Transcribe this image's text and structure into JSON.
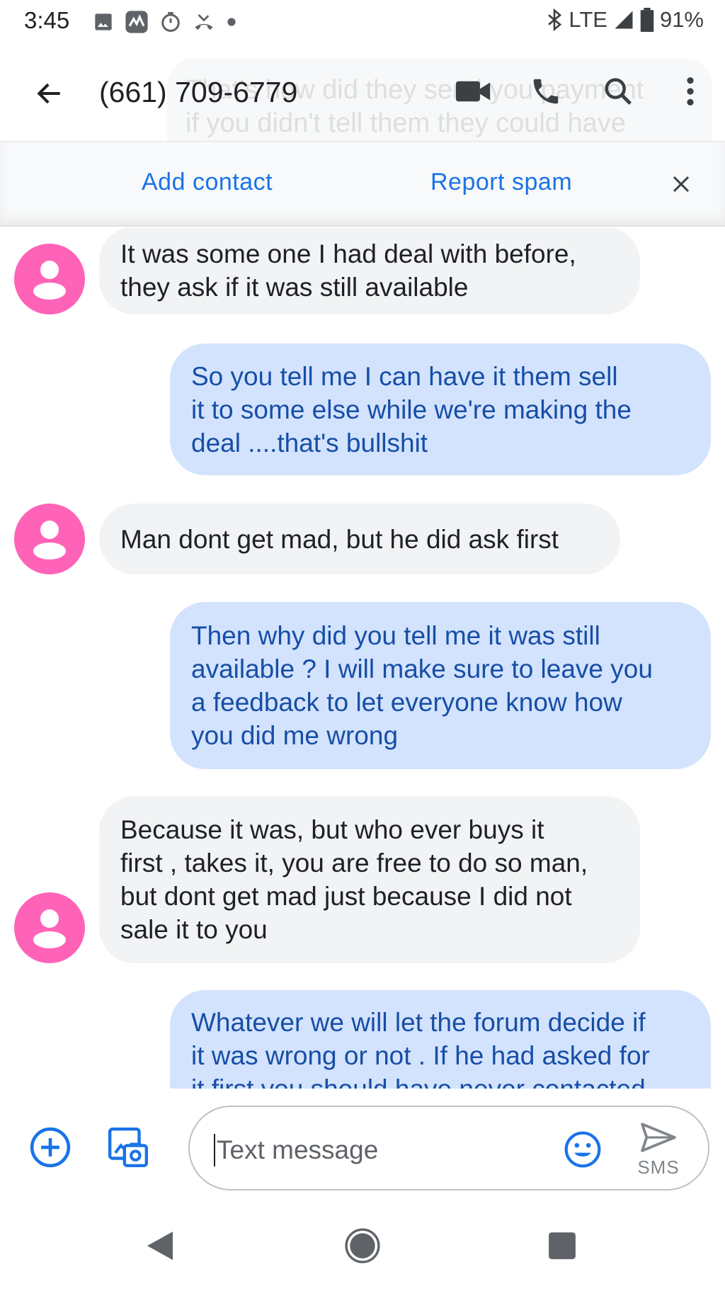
{
  "status_bar": {
    "time": "3:45",
    "network": "LTE",
    "battery": "91%",
    "left_icons": [
      "image-icon",
      "activity-icon",
      "timer-icon",
      "missed-call-icon",
      "dot-icon"
    ],
    "right_icons": [
      "bluetooth-icon",
      "signal-icon",
      "battery-icon"
    ]
  },
  "app_bar": {
    "title": "(661) 709-6779",
    "ghost_text": "That's how did they send you payment if you didn't tell them they could have it",
    "actions": [
      "video-call-icon",
      "phone-icon",
      "search-icon",
      "more-vert-icon"
    ]
  },
  "spam_banner": {
    "add_contact": "Add contact",
    "report_spam": "Report spam"
  },
  "messages": [
    {
      "direction": "in",
      "lines": [
        "It was some one I had deal with before,",
        "they ask if it was still available"
      ]
    },
    {
      "direction": "out",
      "lines": [
        "So you tell me I can have it them sell",
        "it to some else while we're making the",
        "deal ....that's bullshit"
      ]
    },
    {
      "direction": "in",
      "lines": [
        "Man dont get mad, but he did ask first"
      ]
    },
    {
      "direction": "out",
      "lines": [
        "Then why did you tell me it was still",
        "available ? I will make sure to leave you",
        "a feedback to let everyone know how",
        "you did me wrong"
      ]
    },
    {
      "direction": "in",
      "lines": [
        "Because it was, but who ever buys it",
        "first , takes it, you are free to do so man,",
        "but dont get mad just because I did not",
        "sale it to you"
      ]
    },
    {
      "direction": "out",
      "lines": [
        "Whatever we will let the forum decide if",
        "it was wrong or not . If he had asked for",
        "it first you should have never contacted"
      ]
    }
  ],
  "composer": {
    "placeholder": "Text message",
    "send_label": "SMS"
  },
  "colors": {
    "accent": "#1a73e8",
    "incoming_bubble": "#f1f3f4",
    "outgoing_bubble": "#d3e3fd",
    "outgoing_text": "#174ea6",
    "avatar": "#ff63b8"
  }
}
